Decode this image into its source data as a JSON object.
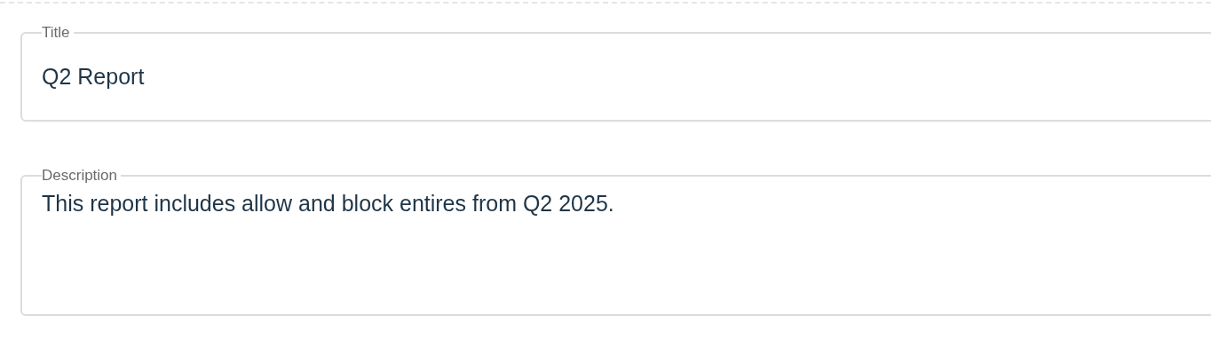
{
  "fields": [
    {
      "kind": "input",
      "label": "Title",
      "value": "Q2 Report"
    },
    {
      "kind": "textarea",
      "label": "Description",
      "value": "This report includes allow and block entires from Q2 2025."
    }
  ]
}
